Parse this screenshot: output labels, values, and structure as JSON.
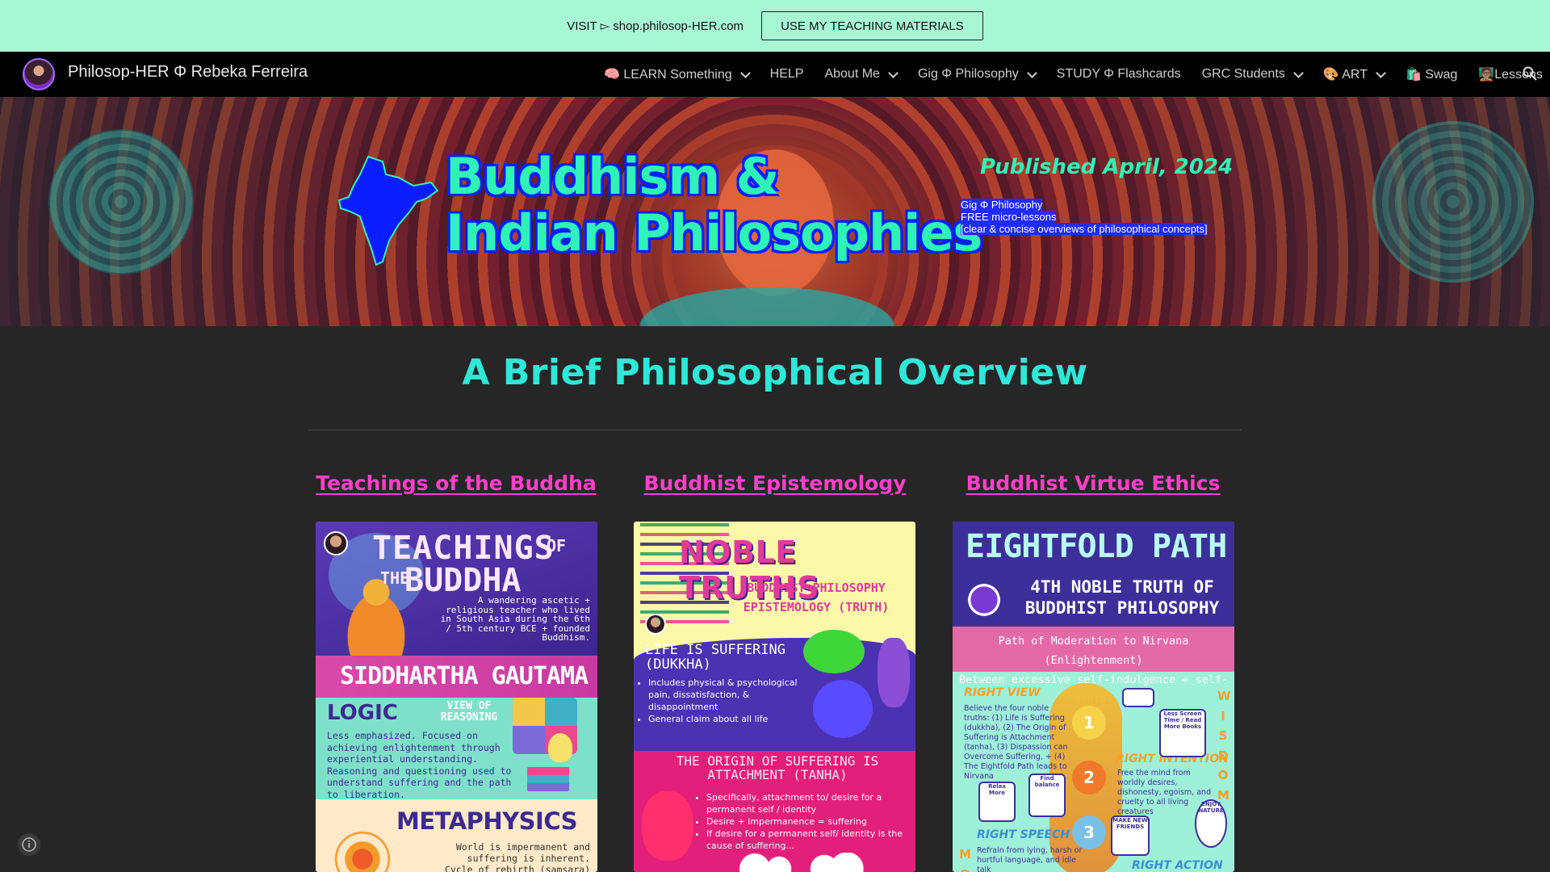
{
  "promo": {
    "text": "VISIT ▻ shop.philosop-HER.com",
    "button": "USE MY TEACHING MATERIALS"
  },
  "nav": {
    "site_title": "Philosop-HER Φ Rebeka Ferreira",
    "items": [
      {
        "label": "🧠 LEARN Something",
        "dropdown": true
      },
      {
        "label": "HELP",
        "dropdown": false
      },
      {
        "label": "About Me",
        "dropdown": true
      },
      {
        "label": "Gig Φ Philosophy",
        "dropdown": true
      },
      {
        "label": "STUDY Φ Flashcards",
        "dropdown": false
      },
      {
        "label": "GRC Students",
        "dropdown": true
      },
      {
        "label": "🎨 ART",
        "dropdown": true
      },
      {
        "label": "🛍️ Swag",
        "dropdown": false
      },
      {
        "label": "🧑🏽‍🏫Lessons",
        "dropdown": false
      }
    ]
  },
  "hero": {
    "title_line1": "Buddhism &",
    "title_line2": "Indian Philosophies",
    "published": "Published April, 2024",
    "sub_line1": "Gig Φ Philosophy",
    "sub_line2": "FREE micro-lessons",
    "sub_line3": "[clear & concise overviews of philosophical concepts]"
  },
  "main": {
    "heading": "A Brief Philosophical Overview",
    "columns": [
      {
        "link": "Teachings of the Buddha"
      },
      {
        "link": "Buddhist Epistemology"
      },
      {
        "link": "Buddhist Virtue Ethics"
      }
    ]
  },
  "card1": {
    "title_a": "TEACHINGS",
    "title_of": "OF",
    "title_the": "THE",
    "title_b": "BUDDHA",
    "desc": "A wandering ascetic + religious teacher who lived in South Asia during the 6th / 5th century BCE + founded Buddhism.",
    "band": "SIDDHARTHA GAUTAMA",
    "logic_title": "LOGIC",
    "logic_sub": "VIEW OF REASONING",
    "logic_desc": "Less emphasized. Focused on achieving enlightenment through experiential understanding. Reasoning and questioning used to understand suffering and the path to liberation.",
    "meta_title": "METAPHYSICS",
    "meta_desc": "World is impermanent and suffering is inherent. Cycle of rebirth (samsara) exists."
  },
  "card2": {
    "title": "NOBLE TRUTHS",
    "sub_line1": "BUDDHIST PHILOSOPHY",
    "sub_line2": "EPISTEMOLOGY (TRUTH)",
    "h1": "LIFE IS SUFFERING (DUKKHA)",
    "l1": [
      "Includes physical & psychological pain, dissatisfaction, & disappointment",
      "General claim about all life"
    ],
    "h2": "THE ORIGIN OF SUFFERING IS ATTACHMENT (TANHA)",
    "l2": [
      "Specifically, attachment to/ desire for a permanent self / identity",
      "Desire + impermanence = suffering",
      "If desire for a permanent self/ identity is the cause of suffering..."
    ]
  },
  "card3": {
    "title": "EIGHTFOLD PATH",
    "sub_line1": "4TH NOBLE TRUTH OF",
    "sub_line2": "BUDDHIST PHILOSOPHY",
    "band_line1": "Path of Moderation to Nirvana (Enlightenment)",
    "band_line2": "Between excessive self-indulgence + self-denial",
    "right_view": "RIGHT VIEW",
    "right_view_desc": "Believe the four noble truths: (1) Life is Suffering (dukkha), (2) The Origin of Suffering is Attachment (tanha), (3) Dispassion can Overcome Suffering, + (4) The Eightfold Path leads to Nirvana",
    "right_intention": "RIGHT INTENTION",
    "right_intention_desc": "Free the mind from worldly desires, dishonesty, egoism, and cruelty to all living creatures",
    "right_speech": "RIGHT SPEECH",
    "right_speech_desc": "Refrain from lying, harsh or hurtful language, and idle talk",
    "right_action": "RIGHT ACTION",
    "n1": "1",
    "n2": "2",
    "n3": "3",
    "wisdom": "W I S D O M",
    "moral": "M O R",
    "sticker1": "Less Screen Time / Read More Books",
    "sticker2": "Relax More",
    "sticker3": "Find balance",
    "sticker4": "MAKE NEW FRIENDS",
    "sticker5": "ENJOY NATURE"
  },
  "colors": {
    "promo_bg": "#a7f7d5",
    "nav_bg": "#000000",
    "page_bg": "#262626",
    "heading": "#2ee8d8",
    "link": "#ff3ec8",
    "hero_title": "#2ef2b6",
    "hero_outline": "#0020ff"
  }
}
